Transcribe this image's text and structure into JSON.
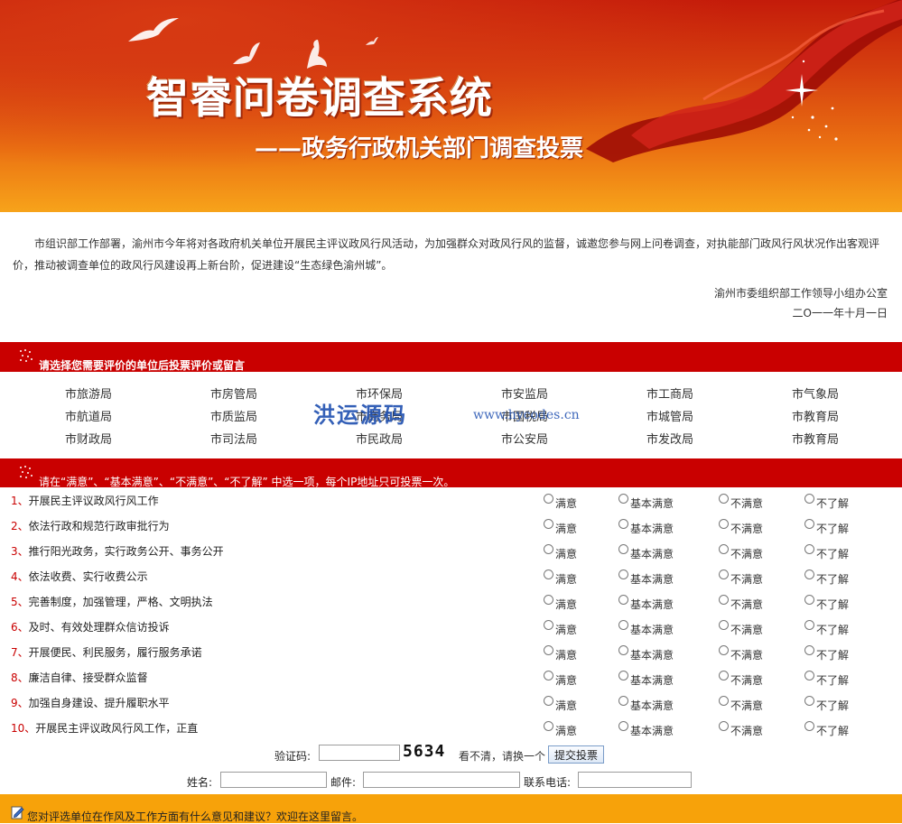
{
  "banner": {
    "title": "智睿问卷调查系统",
    "subtitle": "——政务行政机关部门调查投票"
  },
  "intro": {
    "paragraph": "市组识部工作部署，渝州市今年将对各政府机关单位开展民主评议政风行风活动，为加强群众对政风行风的监督，诚邀您参与网上问卷调查，对执能部门政风行风状况作出客观评价，推动被调查单位的政风行风建设再上新台阶，促进建设“生态绿色渝州城”。",
    "signature_org": "渝州市委组织部工作领导小组办公室",
    "signature_date": "二O一一年十月一日"
  },
  "units_section": {
    "heading": "请选择您需要评价的单位后投票评价或留言",
    "units": [
      [
        "市旅游局",
        "市房管局",
        "市环保局",
        "市安监局",
        "市工商局",
        "市气象局"
      ],
      [
        "市航道局",
        "市质监局",
        "市商务局",
        "市国税局",
        "市城管局",
        "市教育局"
      ],
      [
        "市财政局",
        "市司法局",
        "市民政局",
        "市公安局",
        "市发改局",
        "市教育局"
      ]
    ],
    "watermark": "洪运源码",
    "watermark_url": "www.hycodes.cn"
  },
  "survey_section": {
    "instruction": "请在“满意”、“基本满意”、“不满意”、“不了解” 中选一项，每个IP地址只可投票一次。",
    "options": [
      "满意",
      "基本满意",
      "不满意",
      "不了解"
    ],
    "questions": [
      {
        "num": "1、",
        "text": "开展民主评议政风行风工作"
      },
      {
        "num": "2、",
        "text": "依法行政和规范行政审批行为"
      },
      {
        "num": "3、",
        "text": "推行阳光政务，实行政务公开、事务公开"
      },
      {
        "num": "4、",
        "text": "依法收费、实行收费公示"
      },
      {
        "num": "5、",
        "text": "完善制度，加强管理，严格、文明执法"
      },
      {
        "num": "6、",
        "text": "及时、有效处理群众信访投诉"
      },
      {
        "num": "7、",
        "text": "开展便民、利民服务，履行服务承诺"
      },
      {
        "num": "8、",
        "text": "廉洁自律、接受群众监督"
      },
      {
        "num": "9、",
        "text": "加强自身建设、提升履职水平"
      },
      {
        "num": "10、",
        "text": "开展民主评议政风行风工作，正直"
      }
    ]
  },
  "form": {
    "captcha_label": "验证码:",
    "captcha_value": "",
    "captcha_code": "5634",
    "captcha_refresh": "看不清，请换一个",
    "submit_label": "提交投票",
    "name_label": "姓名:",
    "email_label": "邮件:",
    "phone_label": "联系电话:",
    "name_value": "",
    "email_value": "",
    "phone_value": ""
  },
  "comment_bar": {
    "label": "您对评选单位在作风及工作方面有什么意见和建议？欢迎在这里留言。"
  },
  "colors": {
    "section_red": "#c90000",
    "comment_orange": "#f7a20a",
    "banner_top": "#c41b0a",
    "banner_bottom": "#f7a31a"
  }
}
